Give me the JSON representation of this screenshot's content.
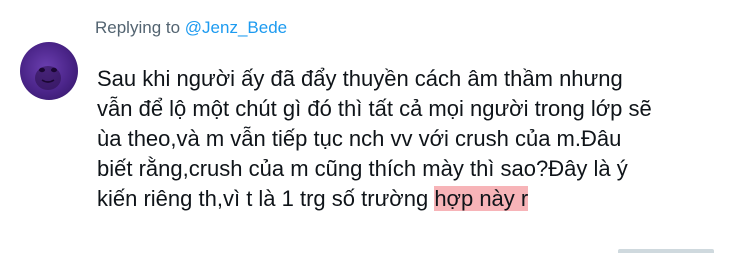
{
  "reply": {
    "prefix": "Replying to ",
    "handle": "@Jenz_Bede"
  },
  "tweet": {
    "lines": [
      "Sau khi người ấy đã đẩy thuyền cách âm thầm nhưng",
      "vẫn để lộ một chút gì đó thì tất cả mọi người trong lớp sẽ",
      "ùa theo,và m vẫn tiếp tục nch vv với crush của m.Đâu",
      "biết rằng,crush của m cũng thích mày thì sao?Đây là ý"
    ],
    "last_line_plain": "kiến riêng th,vì t là 1 trg số trường ",
    "last_line_highlight": "hợp này r"
  },
  "colors": {
    "handle": "#1d9bf0",
    "secondary_text": "#536471",
    "text": "#0f1419",
    "highlight": "#f7b4b8",
    "avatar": "#4a2488"
  },
  "icons": {
    "avatar": "user-avatar"
  }
}
